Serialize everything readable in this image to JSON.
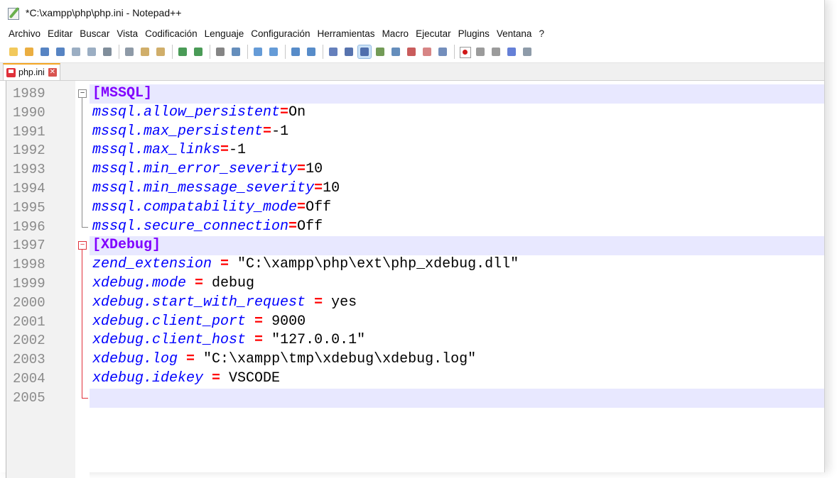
{
  "window": {
    "title": "*C:\\xampp\\php\\php.ini - Notepad++"
  },
  "menu": [
    "Archivo",
    "Editar",
    "Buscar",
    "Vista",
    "Codificación",
    "Lenguaje",
    "Configuración",
    "Herramientas",
    "Macro",
    "Ejecutar",
    "Plugins",
    "Ventana",
    "?"
  ],
  "toolbar": {
    "groups": [
      [
        "new-file-icon",
        "open-file-icon",
        "save-icon",
        "save-all-icon",
        "close-icon",
        "close-all-icon",
        "print-icon"
      ],
      [
        "cut-icon",
        "copy-icon",
        "paste-icon"
      ],
      [
        "undo-icon",
        "redo-icon"
      ],
      [
        "find-icon",
        "replace-icon"
      ],
      [
        "zoom-in-icon",
        "zoom-out-icon"
      ],
      [
        "sync-vertical-icon",
        "sync-horizontal-icon"
      ],
      [
        "word-wrap-icon",
        "show-all-chars-icon",
        "indent-guide-icon",
        "udl-icon",
        "doc-map-icon",
        "function-list-icon",
        "folder-workspace-icon",
        "monitoring-icon"
      ],
      [
        "record-macro-icon",
        "stop-macro-icon",
        "play-macro-icon",
        "run-macro-multiple-icon",
        "save-macro-icon"
      ]
    ],
    "active": "indent-guide-icon"
  },
  "tabs": [
    {
      "label": "php.ini",
      "close": "✕"
    }
  ],
  "editor": {
    "lines": [
      {
        "num": "1989",
        "type": "section",
        "text": "[MSSQL]",
        "fold": "open-gray",
        "highlight": true
      },
      {
        "num": "1990",
        "type": "kv",
        "key": "mssql.allow_persistent",
        "sep": "=",
        "value": "On",
        "fold": "line-gray"
      },
      {
        "num": "1991",
        "type": "kv",
        "key": "mssql.max_persistent",
        "sep": "=",
        "value": "-1",
        "fold": "line-gray"
      },
      {
        "num": "1992",
        "type": "kv",
        "key": "mssql.max_links",
        "sep": "=",
        "value": "-1",
        "fold": "line-gray"
      },
      {
        "num": "1993",
        "type": "kv",
        "key": "mssql.min_error_severity",
        "sep": "=",
        "value": "10",
        "fold": "line-gray"
      },
      {
        "num": "1994",
        "type": "kv",
        "key": "mssql.min_message_severity",
        "sep": "=",
        "value": "10",
        "fold": "line-gray"
      },
      {
        "num": "1995",
        "type": "kv",
        "key": "mssql.compatability_mode",
        "sep": "=",
        "value": "Off",
        "fold": "line-gray"
      },
      {
        "num": "1996",
        "type": "kv",
        "key": "mssql.secure_connection",
        "sep": "=",
        "value": "Off",
        "fold": "end-gray"
      },
      {
        "num": "1997",
        "type": "section",
        "text": "[XDebug]",
        "fold": "open-red",
        "highlight": true
      },
      {
        "num": "1998",
        "type": "kv",
        "key": "zend_extension",
        "sep": " = ",
        "value": "\"C:\\xampp\\php\\ext\\php_xdebug.dll\"",
        "fold": "line-red"
      },
      {
        "num": "1999",
        "type": "kv",
        "key": "xdebug.mode",
        "sep": " = ",
        "value": "debug",
        "fold": "line-red"
      },
      {
        "num": "2000",
        "type": "kv",
        "key": "xdebug.start_with_request",
        "sep": " = ",
        "value": "yes",
        "fold": "line-red"
      },
      {
        "num": "2001",
        "type": "kv",
        "key": "xdebug.client_port",
        "sep": " = ",
        "value": "9000",
        "fold": "line-red"
      },
      {
        "num": "2002",
        "type": "kv",
        "key": "xdebug.client_host",
        "sep": " = ",
        "value": "\"127.0.0.1\"",
        "fold": "line-red"
      },
      {
        "num": "2003",
        "type": "kv",
        "key": "xdebug.log",
        "sep": " = ",
        "value": "\"C:\\xampp\\tmp\\xdebug\\xdebug.log\"",
        "fold": "line-red"
      },
      {
        "num": "2004",
        "type": "kv",
        "key": "xdebug.idekey",
        "sep": " = ",
        "value": "VSCODE",
        "fold": "line-red"
      },
      {
        "num": "2005",
        "type": "empty",
        "fold": "end-red",
        "highlight": true,
        "current": true
      }
    ]
  },
  "colors": {
    "section": "#8000ff",
    "key": "#0000ff",
    "operator": "#ff0000",
    "current_line": "#e8e8ff",
    "tab_accent": "#f5a623"
  }
}
